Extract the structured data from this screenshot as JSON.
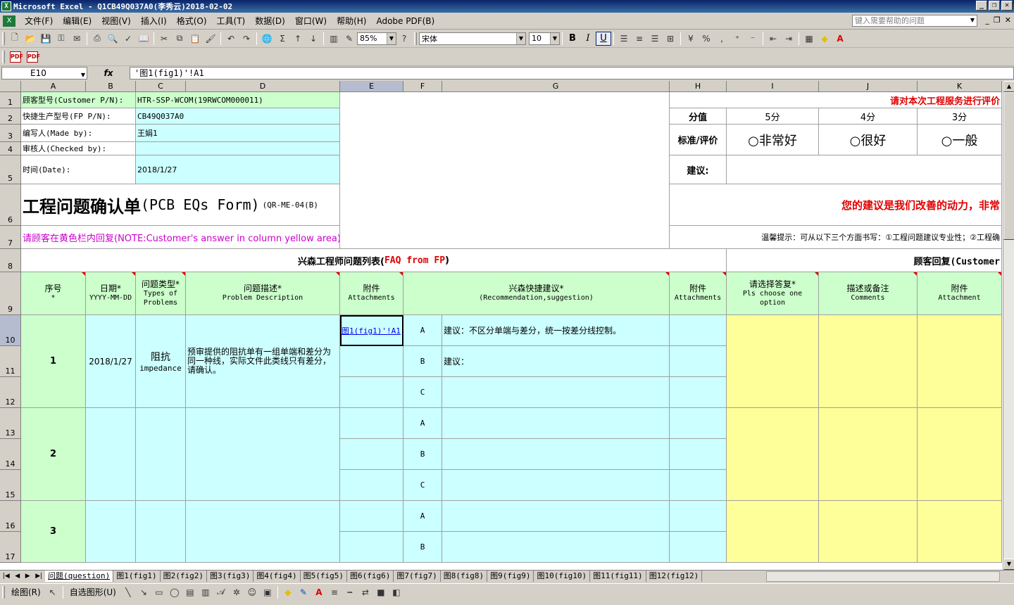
{
  "window": {
    "title": "Microsoft Excel - Q1CB49Q037A0(李秀云)2018-02-02",
    "app_icon": "excel-icon",
    "minimize": "_",
    "restore": "❐",
    "close": "✕"
  },
  "menu": {
    "items": [
      "文件(F)",
      "编辑(E)",
      "视图(V)",
      "插入(I)",
      "格式(O)",
      "工具(T)",
      "数据(D)",
      "窗口(W)",
      "帮助(H)",
      "Adobe PDF(B)"
    ],
    "help_placeholder": "键入需要帮助的问题"
  },
  "toolbar": {
    "zoom": "85%",
    "font_name": "宋体",
    "font_size": "10",
    "bold": "B",
    "italic": "I",
    "underline": "U"
  },
  "formula_bar": {
    "name_box": "E10",
    "fx": "fx",
    "formula": "'图1(fig1)'!A1"
  },
  "columns": [
    "A",
    "B",
    "C",
    "D",
    "E",
    "F",
    "G",
    "H",
    "I",
    "J",
    "K"
  ],
  "rows": [
    "1",
    "2",
    "3",
    "4",
    "5",
    "6",
    "7",
    "8",
    "9",
    "10",
    "11",
    "12",
    "13",
    "14",
    "15",
    "16",
    "17"
  ],
  "header_info": {
    "customer_pn_label": "顾客型号(Customer P/N):",
    "customer_pn_value": "HTR-SSP-WCOM(19RWCOM000011)",
    "fp_pn_label": "快捷生产型号(FP P/N):",
    "fp_pn_value": "CB49Q037A0",
    "made_by_label": "编写人(Made by):",
    "made_by_value": "王娟1",
    "checked_by_label": "审核人(Checked by):",
    "date_label": "时间(Date):",
    "date_value": "2018/1/27",
    "form_title": "工程问题确认单",
    "form_title_en": "(PCB EQs Form)",
    "form_code": "(QR-ME-04(B)",
    "note": "请顾客在黄色栏内回复(NOTE:Customer's answer in column yellow area)"
  },
  "rating": {
    "title": "请对本次工程服务进行评价",
    "score_label": "分值",
    "scores": [
      "5分",
      "4分",
      "3分"
    ],
    "criteria_label": "标准/评价",
    "options": [
      "○非常好",
      "○很好",
      "○一般"
    ],
    "suggestion_label": "建议:",
    "motivation": "您的建议是我们改善的动力，非常",
    "tip": "温馨提示：可从以下三个方面书写：①工程问题建议专业性；②工程确"
  },
  "table": {
    "section_fp": "兴森工程师问题列表(",
    "section_fp_en": "FAQ from FP",
    "section_fp_close": ")",
    "section_customer": "顾客回复(Customer",
    "headers": {
      "no": "序号",
      "no_star": "*",
      "date": "日期*",
      "date_fmt": "YYYY-MM-DD",
      "type": "问题类型*",
      "type_en": "Types of Problems",
      "desc": "问题描述*",
      "desc_en": "Problem Description",
      "attach": "附件",
      "attach_en": "Attachments",
      "suggest": "兴森快捷建议*",
      "suggest_en": "(Recommendation,suggestion)",
      "attach2": "附件",
      "attach2_en": "Attachments",
      "choose": "请选择答复*",
      "choose_en": "Pls choose one option",
      "comments": "描述或备注",
      "comments_en": "Comments",
      "attach3": "附件",
      "attach3_en": "Attachment"
    },
    "items": [
      {
        "no": "1",
        "date": "2018/1/27",
        "type": "阻抗",
        "type_en": "impedance",
        "desc": "预审提供的阻抗单有一组单端和差分为同一种线，实际文件此类线只有差分，请确认。",
        "attach_link": "图1(fig1)'!A1",
        "options": [
          {
            "letter": "A",
            "text": "建议：不区分单端与差分，统一按差分线控制。"
          },
          {
            "letter": "B",
            "text": "建议："
          },
          {
            "letter": "C",
            "text": ""
          }
        ]
      },
      {
        "no": "2",
        "options": [
          {
            "letter": "A",
            "text": ""
          },
          {
            "letter": "B",
            "text": ""
          },
          {
            "letter": "C",
            "text": ""
          }
        ]
      },
      {
        "no": "3",
        "options": [
          {
            "letter": "A",
            "text": ""
          },
          {
            "letter": "B",
            "text": ""
          }
        ]
      }
    ]
  },
  "sheet_tabs": [
    "问题(question)",
    "图1(fig1)",
    "图2(fig2)",
    "图3(fig3)",
    "图4(fig4)",
    "图5(fig5)",
    "图6(fig6)",
    "图7(fig7)",
    "图8(fig8)",
    "图9(fig9)",
    "图10(fig10)",
    "图11(fig11)",
    "图12(fig12)"
  ],
  "drawing_toolbar": {
    "draw": "绘图(R)",
    "autoshapes": "自选图形(U)"
  },
  "colors": {
    "cyan": "#ccffff",
    "green": "#ccffcc",
    "yellow": "#ffff99",
    "red": "#e00000",
    "magenta": "#cc00cc"
  }
}
